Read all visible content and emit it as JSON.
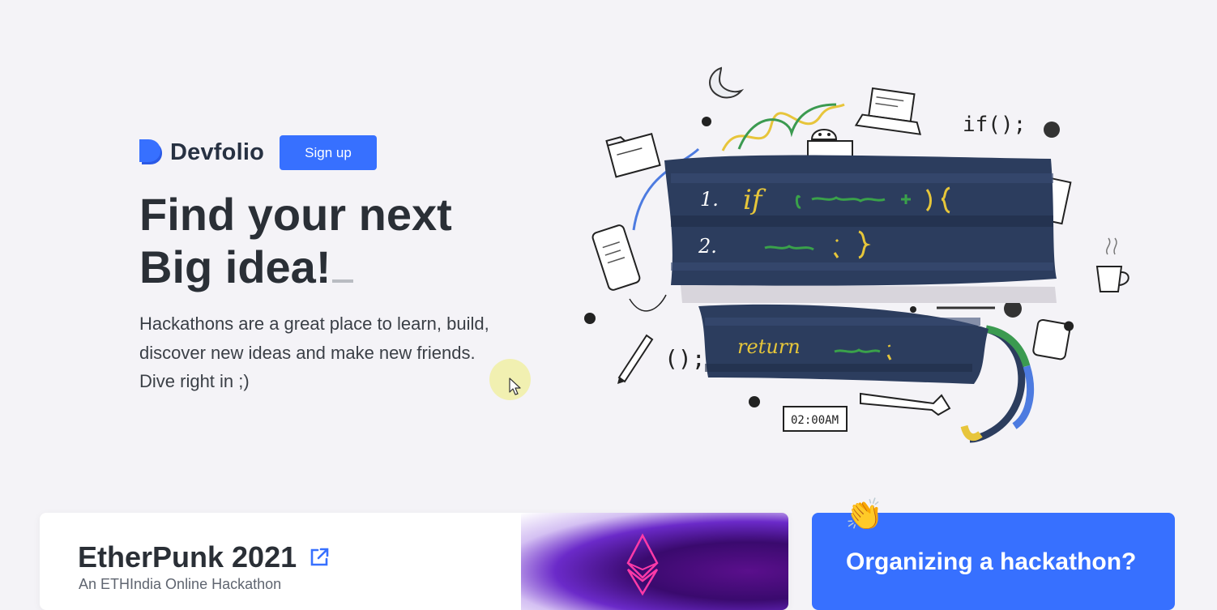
{
  "brand": {
    "name": "Devfolio",
    "logo_icon": "devfolio-logo-icon",
    "accent": "#3770ff"
  },
  "nav": {
    "signup_label": "Sign up"
  },
  "hero": {
    "headline_line1": "Find your next",
    "headline_line2": "Big idea!",
    "description": "Hackathons are a great place to learn, build, discover new ideas and make new friends. Dive right in ;)"
  },
  "illustration": {
    "code_line1_number": "1.",
    "code_line1_keyword": "if",
    "code_line2_number": "2.",
    "code_line3_keyword": "return",
    "if_sketch_text": "if();",
    "parens_sketch_text": "();",
    "clock_text": "02:00AM"
  },
  "event_card": {
    "title": "EtherPunk 2021",
    "subtitle": "An ETHIndia Online Hackathon",
    "link_icon": "external-link-icon"
  },
  "organizer_card": {
    "title": "Organizing a hackathon?",
    "emoji": "👏"
  },
  "colors": {
    "page_bg": "#f4f3f7",
    "button_bg": "#3770ff",
    "code_panel": "#2c3d5e",
    "code_yellow": "#e6c63a",
    "code_green": "#3aa24a"
  }
}
